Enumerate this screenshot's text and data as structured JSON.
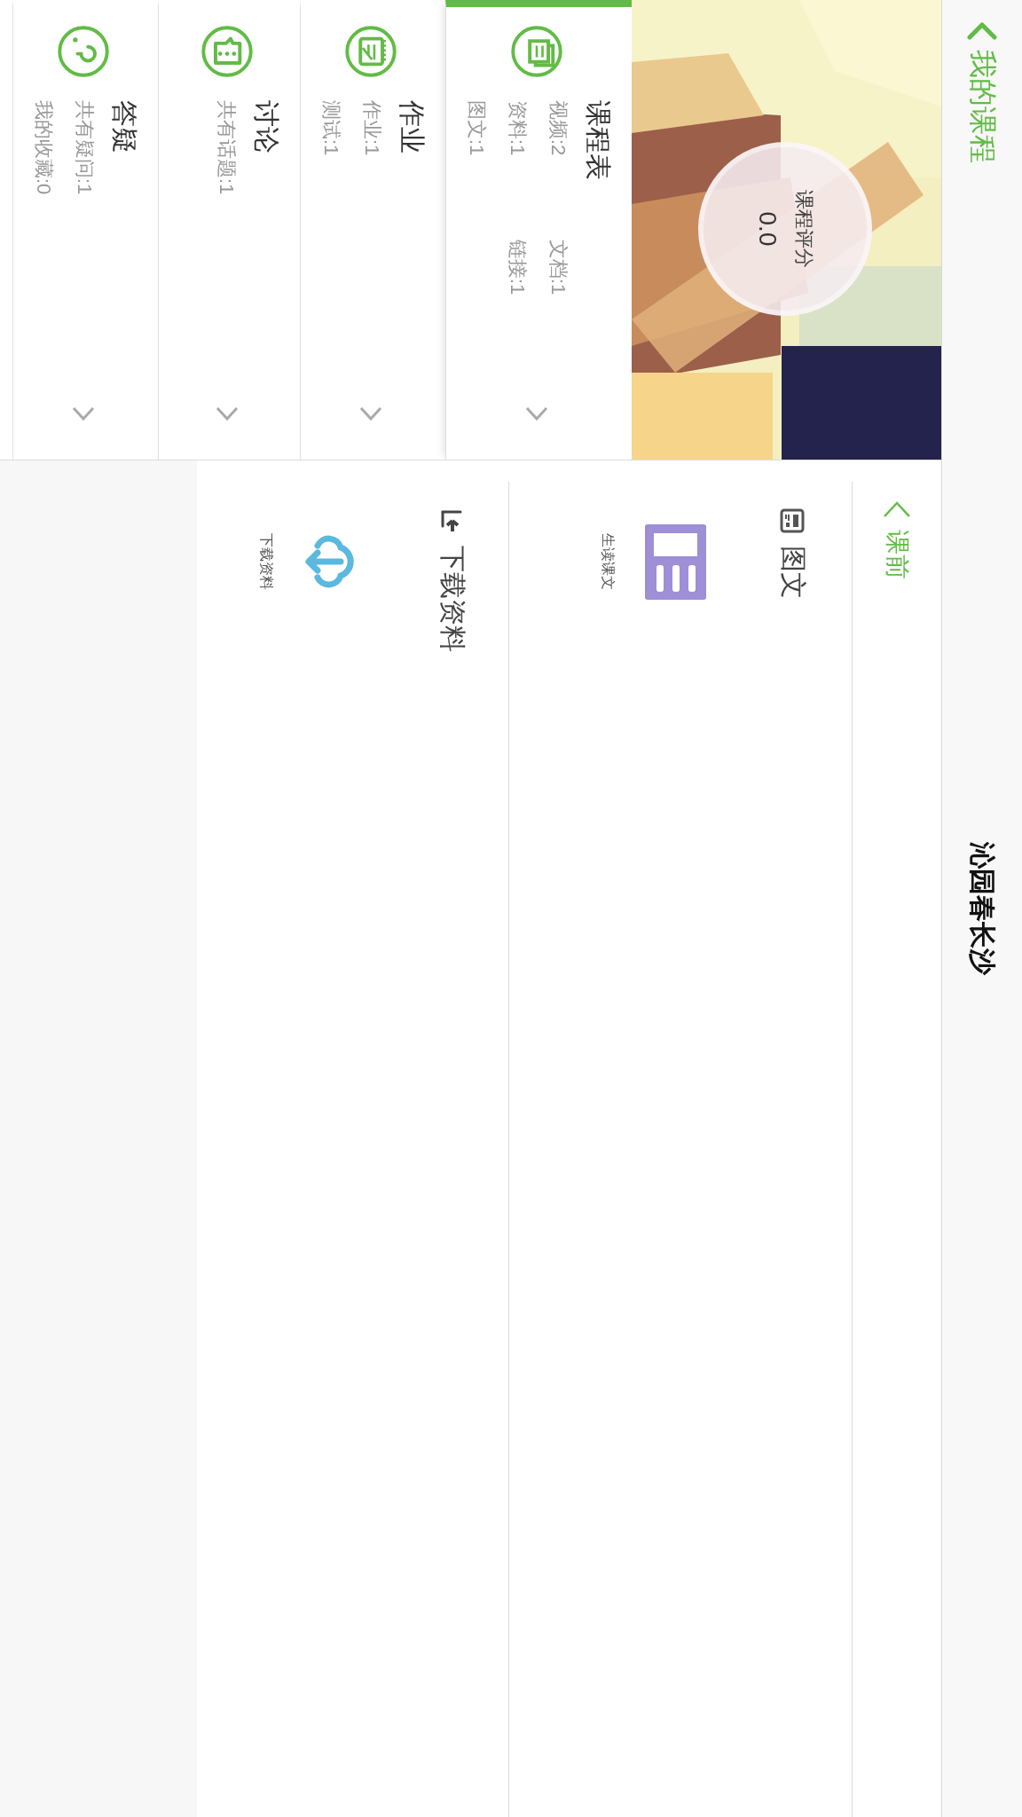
{
  "top_bar": {
    "back_label": "我的课程",
    "title": "沁园春长沙"
  },
  "cover": {
    "kind": "picture",
    "rating_label": "课程评分",
    "rating": "0.0"
  },
  "menu": [
    {
      "kind": "schedule",
      "title": "课程表",
      "selected": true,
      "stats": [
        "视频:2",
        "文档:1",
        "资料:1",
        "链接:1",
        "图文:1"
      ]
    },
    {
      "kind": "homework",
      "title": "作业",
      "selected": false,
      "stats": [
        "作业:1",
        "测试:1"
      ]
    },
    {
      "kind": "discussion",
      "title": "讨论",
      "selected": false,
      "stats": [
        "共有话题:1"
      ]
    },
    {
      "kind": "qa",
      "title": "答疑",
      "selected": false,
      "stats": [
        "共有疑问:1",
        "我的收藏:0"
      ]
    }
  ],
  "phase_tab": {
    "label": "课前"
  },
  "sections": [
    {
      "kind": "article",
      "title": "图文",
      "items": [
        {
          "kind": "lesson",
          "caption": "生读课文"
        }
      ]
    },
    {
      "kind": "download",
      "title": "下载资料",
      "items": [
        {
          "kind": "cloud",
          "caption": "下载资料"
        }
      ]
    }
  ]
}
